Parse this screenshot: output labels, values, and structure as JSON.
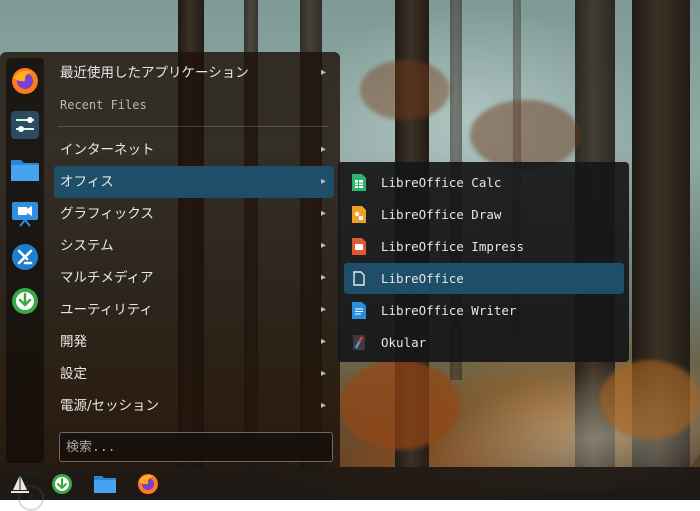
{
  "menu": {
    "categories": [
      {
        "label": "最近使用したアプリケーション",
        "arrow": "▸"
      },
      {
        "label": "インターネット",
        "arrow": "▸"
      },
      {
        "label": "オフィス",
        "arrow": "▸"
      },
      {
        "label": "グラフィックス",
        "arrow": "▸"
      },
      {
        "label": "システム",
        "arrow": "▸"
      },
      {
        "label": "マルチメディア",
        "arrow": "▸"
      },
      {
        "label": "ユーティリティ",
        "arrow": "▸"
      },
      {
        "label": "開発",
        "arrow": "▸"
      },
      {
        "label": "設定",
        "arrow": "▸"
      },
      {
        "label": "電源/セッション",
        "arrow": "▸"
      }
    ],
    "recent_files_label": "Recent Files",
    "search_placeholder": "検索...",
    "back_icon": "‹"
  },
  "favorites": [
    "firefox-icon",
    "settings-icon",
    "file-manager-icon",
    "presentation-icon",
    "software-center-icon",
    "update-icon"
  ],
  "submenu": {
    "items": [
      {
        "label": "LibreOffice Calc",
        "icon": "calc-icon"
      },
      {
        "label": "LibreOffice Draw",
        "icon": "draw-icon"
      },
      {
        "label": "LibreOffice Impress",
        "icon": "impress-icon"
      },
      {
        "label": "LibreOffice",
        "icon": "libreoffice-icon"
      },
      {
        "label": "LibreOffice Writer",
        "icon": "writer-icon"
      },
      {
        "label": "Okular",
        "icon": "okular-icon"
      }
    ]
  },
  "colors": {
    "highlight": "#1f4e6a",
    "calc": "#2db36a",
    "draw": "#f0a020",
    "impress": "#e05a30",
    "writer": "#2a8ee0"
  }
}
